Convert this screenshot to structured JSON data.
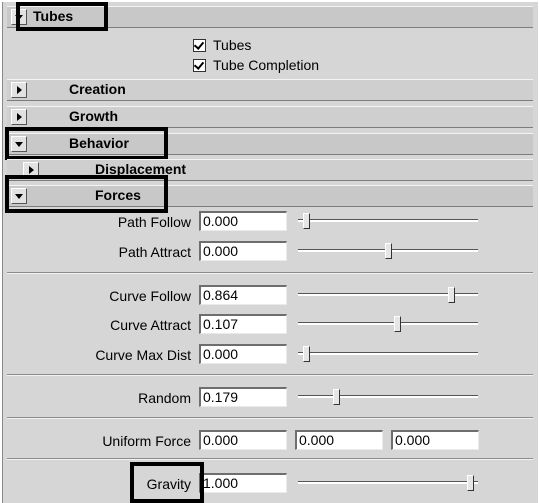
{
  "frames": {
    "tubes": {
      "title": "Tubes",
      "expanded": true
    },
    "creation": {
      "title": "Creation",
      "expanded": false
    },
    "growth": {
      "title": "Growth",
      "expanded": false
    },
    "behavior": {
      "title": "Behavior",
      "expanded": true
    },
    "displacement": {
      "title": "Displacement",
      "expanded": false
    },
    "forces": {
      "title": "Forces",
      "expanded": true
    }
  },
  "checkboxes": [
    {
      "label": "Tubes",
      "checked": true
    },
    {
      "label": "Tube Completion",
      "checked": true
    }
  ],
  "attributes": {
    "path_follow": {
      "label": "Path Follow",
      "value": "0.000",
      "slider_fraction": 0.03
    },
    "path_attract": {
      "label": "Path Attract",
      "value": "0.000",
      "slider_fraction": 0.5
    },
    "curve_follow": {
      "label": "Curve Follow",
      "value": "0.864",
      "slider_fraction": 0.86
    },
    "curve_attract": {
      "label": "Curve Attract",
      "value": "0.107",
      "slider_fraction": 0.55
    },
    "curve_max_dist": {
      "label": "Curve Max Dist",
      "value": "0.000",
      "slider_fraction": 0.03
    },
    "random": {
      "label": "Random",
      "value": "0.179",
      "slider_fraction": 0.2
    },
    "uniform_force": {
      "label": "Uniform Force",
      "values": [
        "0.000",
        "0.000",
        "0.000"
      ]
    },
    "gravity": {
      "label": "Gravity",
      "value": "1.000",
      "slider_fraction": 0.97
    }
  },
  "colors": {
    "panel_bg": "#d6d6d6",
    "field_bg": "#ffffff",
    "highlight": "#000000"
  }
}
